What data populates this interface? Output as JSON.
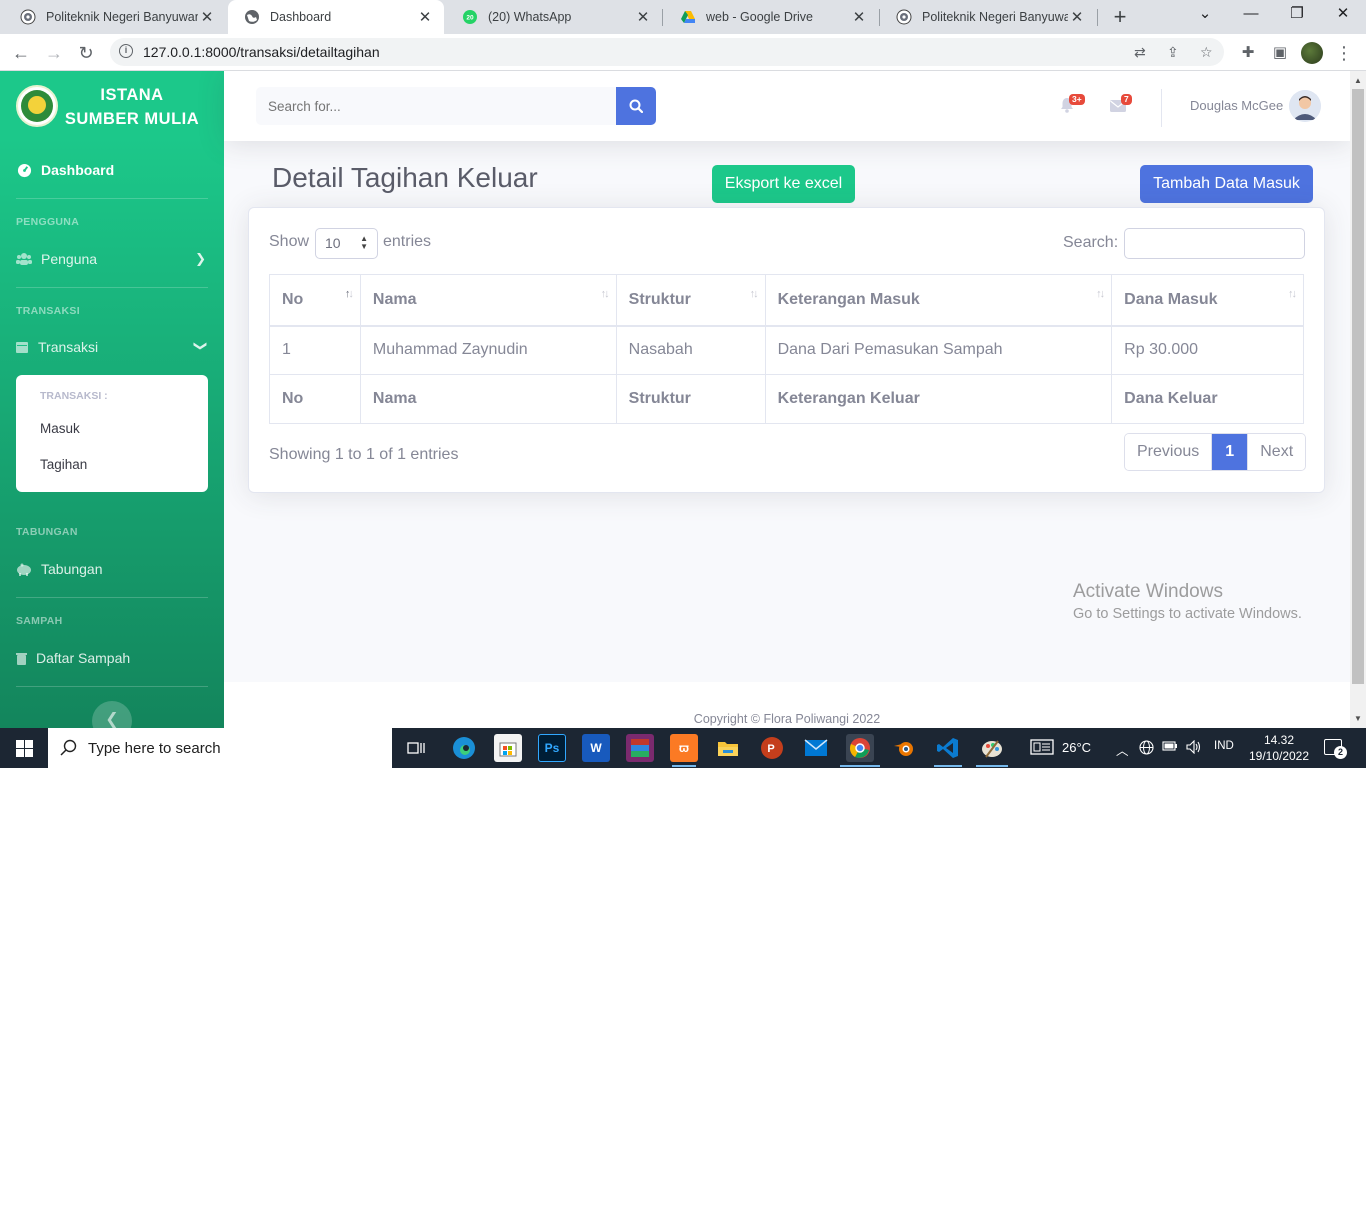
{
  "browser": {
    "tabs": [
      {
        "title": "Politeknik Negeri Banyuwangi",
        "active": false,
        "icon": "pnb-logo-icon"
      },
      {
        "title": "Dashboard",
        "active": true,
        "icon": "globe-icon"
      },
      {
        "title": "(20) WhatsApp",
        "active": false,
        "icon": "whatsapp-icon",
        "badge": "20"
      },
      {
        "title": "web - Google Drive",
        "active": false,
        "icon": "google-drive-icon"
      },
      {
        "title": "Politeknik Negeri Banyuwangi",
        "active": false,
        "icon": "pnb-logo-icon"
      }
    ],
    "url": "127.0.0.1:8000/transaksi/detailtagihan"
  },
  "sidebar": {
    "brand_line1": "ISTANA",
    "brand_line2": "SUMBER MULIA",
    "dashboard_label": "Dashboard",
    "heading_pengguna": "PENGGUNA",
    "penguna_label": "Penguna",
    "heading_transaksi": "TRANSAKSI",
    "transaksi_label": "Transaksi",
    "submenu": {
      "heading": "TRANSAKSI :",
      "items": [
        "Masuk",
        "Tagihan"
      ]
    },
    "heading_tabungan": "TABUNGAN",
    "tabungan_label": "Tabungan",
    "heading_sampah": "SAMPAH",
    "sampah_label": "Daftar Sampah"
  },
  "topbar": {
    "search_placeholder": "Search for...",
    "alerts_badge": "3+",
    "messages_badge": "7",
    "username": "Douglas McGee"
  },
  "page": {
    "title": "Detail Tagihan Keluar",
    "export_button": "Eksport ke excel",
    "add_button": "Tambah Data Masuk"
  },
  "datatable": {
    "show_label": "Show",
    "entries_value": "10",
    "entries_label": "entries",
    "search_label": "Search:",
    "columns": [
      "No",
      "Nama",
      "Struktur",
      "Keterangan Masuk",
      "Dana Masuk"
    ],
    "rows": [
      [
        "1",
        "Muhammad Zaynudin",
        "Nasabah",
        "Dana Dari Pemasukan Sampah",
        "Rp 30.000"
      ]
    ],
    "footer_columns": [
      "No",
      "Nama",
      "Struktur",
      "Keterangan Keluar",
      "Dana Keluar"
    ],
    "info": "Showing 1 to 1 of 1 entries",
    "pagination": {
      "previous": "Previous",
      "current": "1",
      "next": "Next"
    }
  },
  "footer": {
    "copyright": "Copyright © Flora Poliwangi 2022"
  },
  "watermark": {
    "line1": "Activate Windows",
    "line2": "Go to Settings to activate Windows."
  },
  "taskbar": {
    "search_placeholder": "Type here to search",
    "weather": "26°C",
    "language": "IND",
    "time": "14.32",
    "date": "19/10/2022",
    "notifications": "2"
  }
}
